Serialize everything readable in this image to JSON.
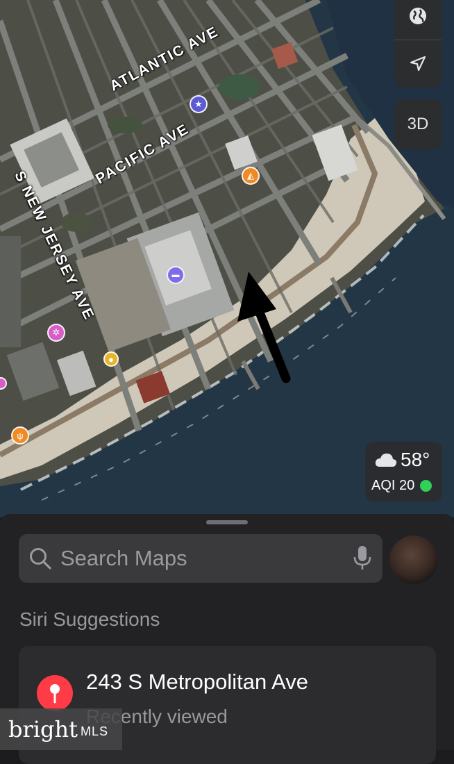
{
  "map": {
    "streets": {
      "atlantic": "ATLANTIC AVE",
      "pacific": "PACIFIC AVE",
      "new_jersey": "S NEW JERSEY AVE"
    },
    "controls": {
      "globe_icon": "globe-icon",
      "location_icon": "location-arrow-icon",
      "three_d": "3D"
    },
    "weather": {
      "icon": "cloud-icon",
      "temperature": "58°",
      "aqi_label": "AQI 20",
      "aqi_color": "#30d158"
    },
    "colors": {
      "ocean": "#253848",
      "beach": "#d8d2c4",
      "land": "#4f5148"
    }
  },
  "sheet": {
    "search": {
      "placeholder": "Search Maps",
      "value": ""
    },
    "section_title": "Siri Suggestions",
    "suggestions": [
      {
        "title": "243 S Metropolitan Ave",
        "subtitle": "Recently viewed",
        "pin_color": "#ff3b47"
      }
    ]
  },
  "watermark": {
    "brand": "bright",
    "suffix": "MLS"
  }
}
